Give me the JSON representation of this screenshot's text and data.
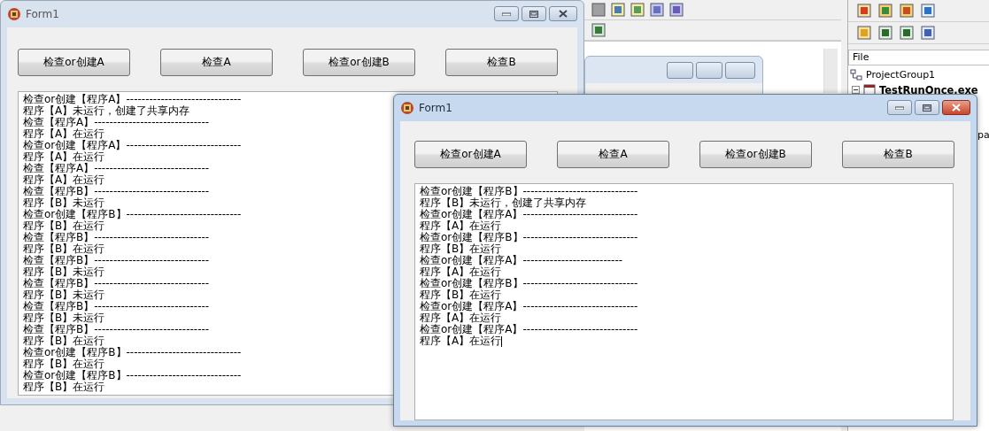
{
  "ide": {
    "project_header": "File",
    "project_tree": [
      {
        "label": "ProjectGroup1",
        "children": [
          {
            "label": "TestRunOnce.exe",
            "expanded": true
          }
        ]
      }
    ],
    "cut_text": "pa"
  },
  "windows": [
    {
      "title": "Form1",
      "active": false,
      "buttons": [
        "检查or创建A",
        "检查A",
        "检查or创建B",
        "检查B"
      ],
      "log": [
        "检查or创建【程序A】------------------------------",
        "程序【A】未运行，创建了共享内存",
        "检查【程序A】------------------------------",
        "程序【A】在运行",
        "检查or创建【程序A】------------------------------",
        "程序【A】在运行",
        "检查【程序A】------------------------------",
        "程序【A】在运行",
        "检查【程序B】------------------------------",
        "程序【B】未运行",
        "检查or创建【程序B】------------------------------",
        "程序【B】在运行",
        "检查【程序B】------------------------------",
        "程序【B】在运行",
        "检查【程序B】------------------------------",
        "程序【B】未运行",
        "检查【程序B】------------------------------",
        "程序【B】未运行",
        "检查【程序B】------------------------------",
        "程序【B】未运行",
        "检查【程序B】------------------------------",
        "程序【B】在运行",
        "检查or创建【程序B】------------------------------",
        "程序【B】在运行",
        "检查or创建【程序B】------------------------------",
        "程序【B】在运行"
      ]
    },
    {
      "title": "Form1",
      "active": true,
      "buttons": [
        "检查or创建A",
        "检查A",
        "检查or创建B",
        "检查B"
      ],
      "log": [
        "检查or创建【程序B】------------------------------",
        "程序【B】未运行，创建了共享内存",
        "检查or创建【程序A】------------------------------",
        "程序【A】在运行",
        "检查or创建【程序B】------------------------------",
        "程序【B】在运行",
        "检查or创建【程序A】--------------------------",
        "程序【A】在运行",
        "检查or创建【程序B】------------------------------",
        "程序【B】在运行",
        "检查or创建【程序A】------------------------------",
        "程序【A】在运行",
        "检查or创建【程序A】------------------------------",
        "程序【A】在运行"
      ]
    }
  ]
}
